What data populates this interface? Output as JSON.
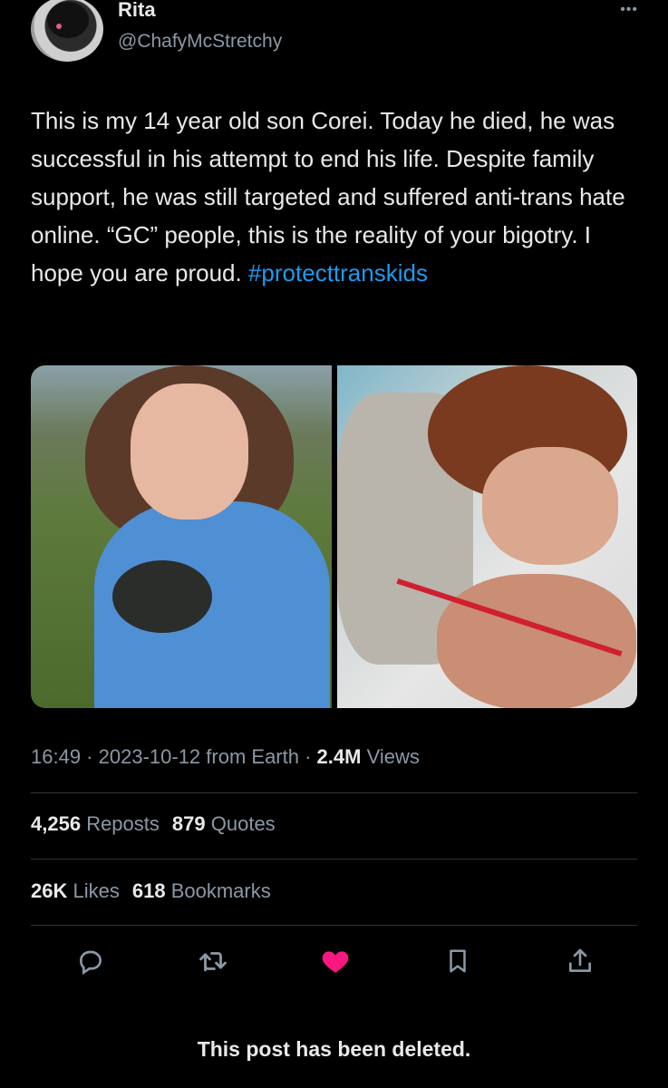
{
  "author": {
    "name": "Rita",
    "handle": "@ChafyMcStretchy"
  },
  "tweet": {
    "text": "This is my 14 year old son Corei. Today he died, he was successful in his attempt to end his life. Despite family support, he was still targeted and suffered anti-trans hate online. “GC” people, this is the reality of your bigotry. I hope you are proud.",
    "hashtag": "#protecttranskids"
  },
  "meta": {
    "time": "16:49",
    "separator1": " · ",
    "date": "2023-10-12",
    "source": " from Earth",
    "separator2": " · ",
    "views_count": "2.4M",
    "views_label": " Views"
  },
  "stats": {
    "reposts_count": "4,256",
    "reposts_label": "Reposts",
    "quotes_count": "879",
    "quotes_label": "Quotes",
    "likes_count": "26K",
    "likes_label": "Likes",
    "bookmarks_count": "618",
    "bookmarks_label": "Bookmarks"
  },
  "actions": [
    {
      "icon": "reply-icon"
    },
    {
      "icon": "repost-icon"
    },
    {
      "icon": "like-icon",
      "color": "#f91880"
    },
    {
      "icon": "bookmark-icon"
    },
    {
      "icon": "share-icon"
    }
  ],
  "footer": {
    "deleted_notice": "This post has been deleted."
  },
  "colors": {
    "background": "#000000",
    "text": "#e7e9ea",
    "secondary": "#8b98a5",
    "link": "#1d9bf0",
    "like": "#f91880"
  }
}
